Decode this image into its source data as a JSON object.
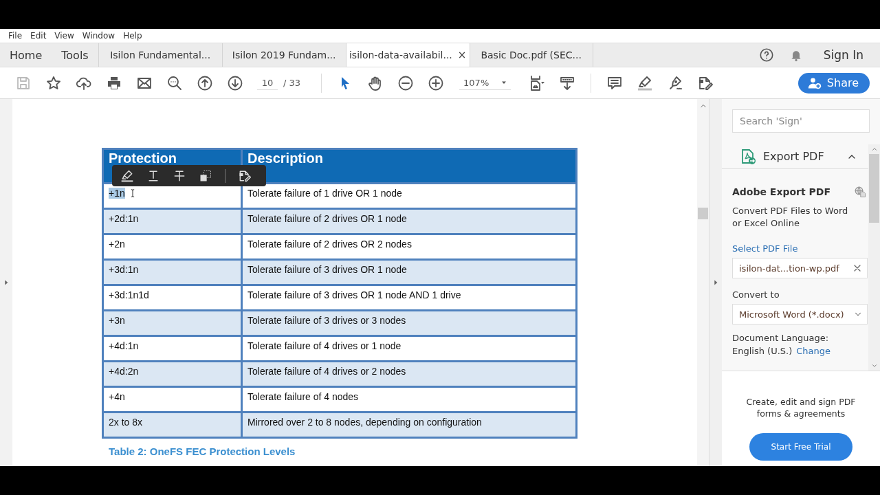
{
  "menu": [
    "File",
    "Edit",
    "View",
    "Window",
    "Help"
  ],
  "tabs": [
    {
      "label": "Home",
      "kind": "nav",
      "selected": false
    },
    {
      "label": "Tools",
      "kind": "nav",
      "selected": false
    },
    {
      "label": "Isilon Fundamental...",
      "kind": "doc",
      "selected": false
    },
    {
      "label": "Isilon 2019 Fundam...",
      "kind": "doc",
      "selected": false
    },
    {
      "label": "isilon-data-availabil...",
      "kind": "doc",
      "selected": true,
      "close": "×"
    },
    {
      "label": "Basic Doc.pdf (SEC...",
      "kind": "doc",
      "selected": false
    }
  ],
  "account": {
    "sign_in": "Sign In"
  },
  "toolbar": {
    "page": "10",
    "page_count": "/ 33",
    "zoom": "107%",
    "share": "Share"
  },
  "table": {
    "columns": [
      "Protection",
      "Description"
    ],
    "rows": [
      {
        "cells": [
          "+1n",
          "Tolerate failure of 1 drive OR 1 node"
        ],
        "highlighted": true
      },
      {
        "cells": [
          "+2d:1n",
          "Tolerate failure of 2 drives OR 1 node"
        ],
        "highlighted": false
      },
      {
        "cells": [
          "+2n",
          "Tolerate failure of 2 drives OR 2 nodes"
        ],
        "highlighted": false
      },
      {
        "cells": [
          "+3d:1n",
          "Tolerate failure of 3 drives OR 1 node"
        ],
        "highlighted": false
      },
      {
        "cells": [
          "+3d:1n1d",
          "Tolerate failure of 3 drives OR 1 node AND 1 drive"
        ],
        "highlighted": false
      },
      {
        "cells": [
          "+3n",
          "Tolerate failure of 3 drives or 3 nodes"
        ],
        "highlighted": false
      },
      {
        "cells": [
          "+4d:1n",
          "Tolerate failure of 4 drives or 1 node"
        ],
        "highlighted": false
      },
      {
        "cells": [
          "+4d:2n",
          "Tolerate failure of 4 drives or 2 nodes"
        ],
        "highlighted": false
      },
      {
        "cells": [
          "+4n",
          "Tolerate failure of 4 nodes"
        ],
        "highlighted": false
      },
      {
        "cells": [
          "2x to 8x",
          "Mirrored over 2 to 8 nodes, depending on configuration"
        ],
        "highlighted": false
      }
    ],
    "caption": "Table 2: OneFS FEC Protection Levels"
  },
  "side_panel": {
    "search": {
      "placeholder": "Search 'Sign'"
    },
    "section": {
      "title": "Export PDF",
      "expanded": true
    },
    "heading": "Adobe Export PDF",
    "description": "Convert PDF Files to Word or Excel Online",
    "select_label": "Select PDF File",
    "file": "isilon-dat...tion-wp.pdf",
    "convert_label": "Convert to",
    "convert_value": "Microsoft Word (*.docx)",
    "language_label": "Document Language:",
    "language": "English (U.S.)",
    "change_link": "Change",
    "promo": "Create, edit and sign PDF forms & agreements",
    "trial_button": "Start Free Trial"
  }
}
